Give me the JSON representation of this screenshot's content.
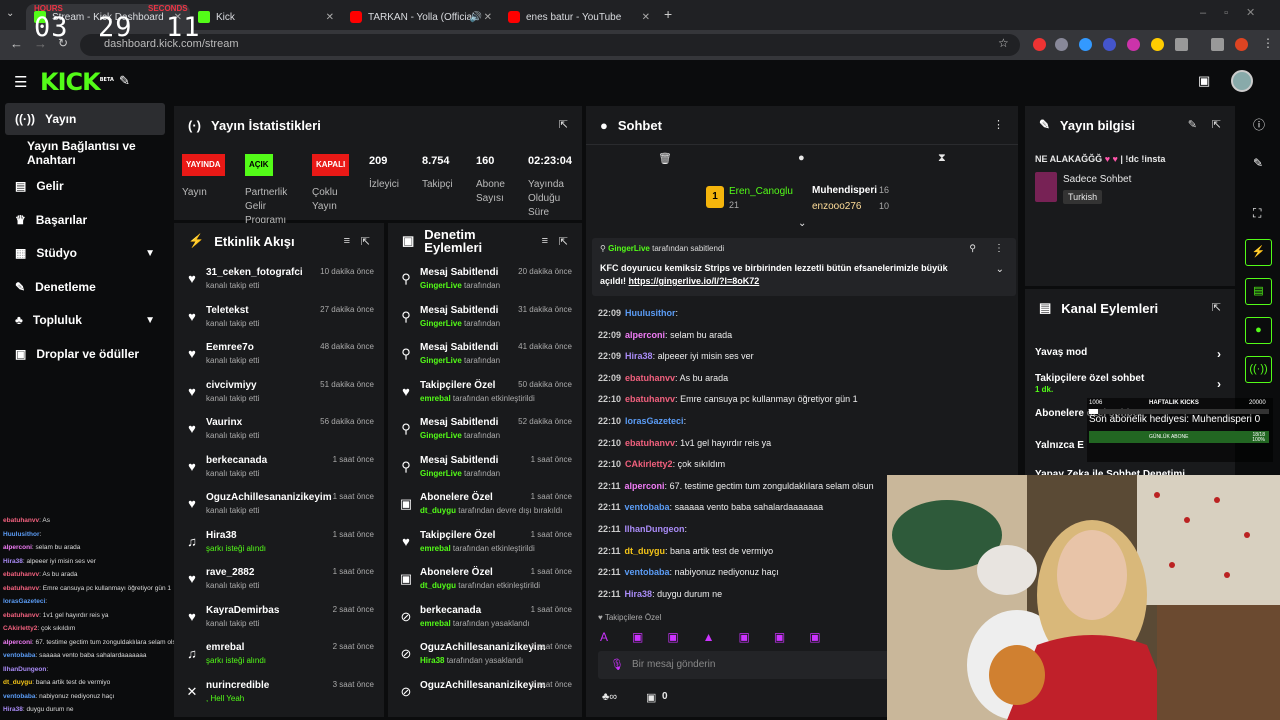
{
  "browser": {
    "tabs": [
      {
        "title": "Stream - Kick Dashboard"
      },
      {
        "title": "Kick"
      },
      {
        "title": "TARKAN - Yolla (Official Mu"
      },
      {
        "title": "enes batur - YouTube"
      }
    ],
    "url": "dashboard.kick.com/stream"
  },
  "clock": {
    "hours": "03",
    "minutes": "29",
    "seconds": "11",
    "hours_label": "HOURS",
    "seconds_label": "SECONDS"
  },
  "app": {
    "logo": "KICK",
    "logo_sup": "BETA"
  },
  "sidebar": {
    "items": [
      {
        "label": "Yayın",
        "icon": "broadcast-icon"
      },
      {
        "label": "Yayın Bağlantısı ve Anahtarı"
      },
      {
        "label": "Gelir",
        "icon": "revenue-icon"
      },
      {
        "label": "Başarılar",
        "icon": "trophy-icon"
      },
      {
        "label": "Stüdyo",
        "icon": "studio-icon"
      },
      {
        "label": "Denetleme",
        "icon": "wrench-icon"
      },
      {
        "label": "Topluluk",
        "icon": "community-icon"
      },
      {
        "label": "Droplar ve ödüller",
        "icon": "gift-icon"
      }
    ]
  },
  "stats": {
    "title": "Yayın İstatistikleri",
    "items": [
      {
        "badge": "YAYINDA",
        "label": "Yayın",
        "color": "#e91916"
      },
      {
        "badge": "AÇIK",
        "label": "Partnerlik Gelir Programı",
        "color": "#53fc18"
      },
      {
        "badge": "KAPALI",
        "label": "Çoklu Yayın",
        "color": "#e91916"
      },
      {
        "value": "209",
        "label": "İzleyici"
      },
      {
        "value": "8.754",
        "label": "Takipçi"
      },
      {
        "value": "160",
        "label": "Abone Sayısı"
      },
      {
        "value": "02:23:04",
        "label": "Yayında Olduğu Süre"
      }
    ]
  },
  "activity": {
    "title": "Etkinlik Akışı",
    "rows": [
      {
        "name": "31_ceken_fotografci",
        "sub": "kanalı takip etti",
        "time": "10 dakika önce"
      },
      {
        "name": "Teletekst",
        "sub": "kanalı takip etti",
        "time": "27 dakika önce"
      },
      {
        "name": "Eemree7o",
        "sub": "kanalı takip etti",
        "time": "48 dakika önce"
      },
      {
        "name": "civcivmiyy",
        "sub": "kanalı takip etti",
        "time": "51 dakika önce"
      },
      {
        "name": "Vaurinx",
        "sub": "kanalı takip etti",
        "time": "56 dakika önce"
      },
      {
        "name": "berkecanada",
        "sub": "kanalı takip etti",
        "time": "1 saat önce"
      },
      {
        "name": "OguzAchillesananizikeyim",
        "sub": "kanalı takip etti",
        "time": "1 saat önce"
      },
      {
        "name": "Hira38",
        "sub": "şarkı isteği alındı",
        "time": "1 saat önce"
      },
      {
        "name": "rave_2882",
        "sub": "kanalı takip etti",
        "time": "1 saat önce"
      },
      {
        "name": "KayraDemirbas",
        "sub": "kanalı takip etti",
        "time": "2 saat önce"
      },
      {
        "name": "emrebal",
        "sub": "şarkı isteği alındı",
        "time": "2 saat önce"
      },
      {
        "name": "nurincredible",
        "sub": ", Hell Yeah",
        "time": "3 saat önce"
      }
    ]
  },
  "moderation": {
    "title": "Denetim Eylemleri",
    "rows": [
      {
        "name": "Mesaj Sabitlendi",
        "user": "GingerLive",
        "sub": "tarafından",
        "time": "20 dakika önce"
      },
      {
        "name": "Mesaj Sabitlendi",
        "user": "GingerLive",
        "sub": "tarafından",
        "time": "31 dakika önce"
      },
      {
        "name": "Mesaj Sabitlendi",
        "user": "GingerLive",
        "sub": "tarafından",
        "time": "41 dakika önce"
      },
      {
        "name": "Takipçilere Özel",
        "user": "emrebal",
        "sub": "tarafından etkinleştirildi",
        "time": "50 dakika önce"
      },
      {
        "name": "Mesaj Sabitlendi",
        "user": "GingerLive",
        "sub": "tarafından",
        "time": "52 dakika önce"
      },
      {
        "name": "Mesaj Sabitlendi",
        "user": "GingerLive",
        "sub": "tarafından",
        "time": "1 saat önce"
      },
      {
        "name": "Abonelere Özel",
        "user": "dt_duygu",
        "sub": "tarafından devre dışı bırakıldı",
        "time": "1 saat önce"
      },
      {
        "name": "Takipçilere Özel",
        "user": "emrebal",
        "sub": "tarafından etkinleştirildi",
        "time": "1 saat önce"
      },
      {
        "name": "Abonelere Özel",
        "user": "dt_duygu",
        "sub": "tarafından etkinleştirildi",
        "time": "1 saat önce"
      },
      {
        "name": "berkecanada",
        "user": "emrebal",
        "sub": "tarafından yasaklandı",
        "time": "1 saat önce"
      },
      {
        "name": "OguzAchillesananizikeyim",
        "user": "Hira38",
        "sub": "tarafından yasaklandı",
        "time": "1 saat önce"
      },
      {
        "name": "OguzAchillesananizikeyim",
        "user": "",
        "sub": "",
        "time": "1 saat önce"
      }
    ]
  },
  "chat": {
    "title": "Sohbet",
    "top": [
      {
        "name": "Eren_Canoglu",
        "count": "21"
      },
      {
        "name": "Muhendisperi",
        "count": "16"
      },
      {
        "name": "enzooo276",
        "count": "10"
      }
    ],
    "pinned_by": "GingerLive",
    "pinned_suffix": "tarafından sabitlendi",
    "pinned_text": "KFC doyurucu kemiksiz Strips ve birbirinden lezzetli bütün efsanelerimizle büyük açıldı!",
    "pinned_link": "https://gingerlive.io/l/?l=8oK72",
    "messages": [
      {
        "time": "22:09",
        "user": "Huulusithor",
        "color": "#5b9cf5",
        "text": ""
      },
      {
        "time": "22:09",
        "user": "alperconi",
        "color": "#f07cf5",
        "text": "selam bu arada"
      },
      {
        "time": "22:09",
        "user": "Hira38",
        "color": "#a98bf6",
        "text": "alpeeer iyi misin ses ver"
      },
      {
        "time": "22:09",
        "user": "ebatuhanvv",
        "color": "#f0607d",
        "text": "As bu arada"
      },
      {
        "time": "22:10",
        "user": "ebatuhanvv",
        "color": "#f0607d",
        "text": "Emre cansuya pc kullanmayı öğretiyor gün 1"
      },
      {
        "time": "22:10",
        "user": "lorasGazeteci",
        "color": "#5b9cf5",
        "text": ""
      },
      {
        "time": "22:10",
        "user": "ebatuhanvv",
        "color": "#f0607d",
        "text": "1v1 gel hayırdır reis ya"
      },
      {
        "time": "22:10",
        "user": "CAkirletty2",
        "color": "#f0607d",
        "text": "çok sıkıldım"
      },
      {
        "time": "22:11",
        "user": "alperconi",
        "color": "#f07cf5",
        "text": "67. testime gectim tum zonguldaklılara selam olsun"
      },
      {
        "time": "22:11",
        "user": "ventobaba",
        "color": "#5b9cf5",
        "text": "saaaaa vento baba sahalardaaaaaaa"
      },
      {
        "time": "22:11",
        "user": "IlhanDungeon",
        "color": "#a98bf6",
        "text": ""
      },
      {
        "time": "22:11",
        "user": "dt_duygu",
        "color": "#f5c518",
        "text": "bana artik test de vermiyo"
      },
      {
        "time": "22:11",
        "user": "ventobaba",
        "color": "#5b9cf5",
        "text": "nabiyonuz nediyonuz haçı"
      },
      {
        "time": "22:11",
        "user": "Hira38",
        "color": "#a98bf6",
        "text": "duygu durum ne"
      }
    ],
    "mode_label": "Takipçilere Özel",
    "input_placeholder": "Bir mesaj gönderin",
    "viewer_count": "0"
  },
  "info": {
    "title": "Yayın bilgisi",
    "stream_title": "NE ALAKAĞĞĞ",
    "stream_title_suffix": "| !dc !insta",
    "category": "Sadece Sohbet",
    "language": "Turkish"
  },
  "channel": {
    "title": "Kanal Eylemleri",
    "actions": [
      {
        "label": "Yavaş mod"
      },
      {
        "label": "Takipçilere özel sohbet",
        "sub": "1 dk."
      },
      {
        "label": "Abonelere özel sohbet"
      },
      {
        "label": "Yalnızca E"
      },
      {
        "label": "Yapay Zeka ile Sohbet Denetimi"
      }
    ]
  },
  "overlay": {
    "kicks_label": "HAFTALIK KICKS",
    "kicks_left": "1006",
    "kicks_right": "20000",
    "sub_gift": "Son abonelik hediyesi: Muhendisperi 0",
    "daily_sub": "GÜNLÜK ABONE",
    "daily_count": "18/18",
    "daily_pct": "100%"
  },
  "mini_chat": [
    {
      "user": "ebatuhanvv",
      "color": "#f0607d",
      "text": "As"
    },
    {
      "user": "Huulusithor",
      "color": "#5b9cf5",
      "text": ""
    },
    {
      "user": "alperconi",
      "color": "#f07cf5",
      "text": "selam bu arada"
    },
    {
      "user": "Hira38",
      "color": "#a98bf6",
      "text": "alpeeer iyi misin ses ver"
    },
    {
      "user": "ebatuhanvv",
      "color": "#f0607d",
      "text": "As bu arada"
    },
    {
      "user": "ebatuhanvv",
      "color": "#f0607d",
      "text": "Emre cansuya pc kullanmayı öğretiyor gün 1"
    },
    {
      "user": "lorasGazeteci",
      "color": "#5b9cf5",
      "text": ""
    },
    {
      "user": "ebatuhanvv",
      "color": "#f0607d",
      "text": "1v1 gel hayırdır reis ya"
    },
    {
      "user": "CAkirletty2",
      "color": "#f0607d",
      "text": "çok sıkıldım"
    },
    {
      "user": "alperconi",
      "color": "#f07cf5",
      "text": "67. testime gectim tum zonguldaklılara selam olsun"
    },
    {
      "user": "ventobaba",
      "color": "#5b9cf5",
      "text": "saaaaa vento baba sahalardaaaaaaa"
    },
    {
      "user": "IlhanDungeon",
      "color": "#a98bf6",
      "text": ""
    },
    {
      "user": "dt_duygu",
      "color": "#f5c518",
      "text": "bana artik test de vermiyo"
    },
    {
      "user": "ventobaba",
      "color": "#5b9cf5",
      "text": "nabiyonuz nediyonuz haçı"
    },
    {
      "user": "Hira38",
      "color": "#a98bf6",
      "text": "duygu durum ne"
    }
  ]
}
